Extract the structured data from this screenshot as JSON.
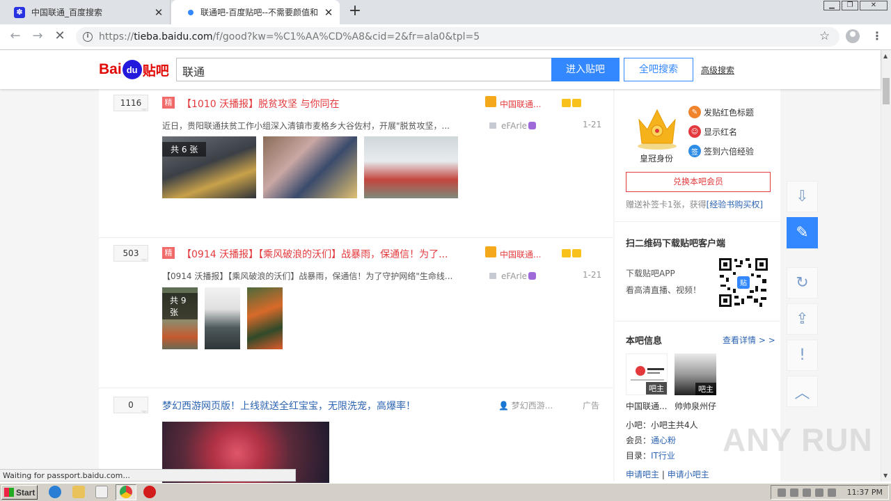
{
  "browser": {
    "tabs": [
      {
        "title": "中国联通_百度搜索",
        "active": false
      },
      {
        "title": "联通吧-百度贴吧--不需要颜值和才华",
        "active": true
      }
    ],
    "new_tab": "+",
    "url_prefix": "https://",
    "url_domain": "tieba.baidu.com",
    "url_path": "/f/good?kw=%C1%AA%CD%A8&cid=2&fr=ala0&tpl=5",
    "status": "Waiting for passport.baidu.com..."
  },
  "header": {
    "logo_bai": "Bai",
    "logo_du": "du",
    "logo_tieba": "贴吧",
    "search_value": "联通",
    "enter_bar": "进入贴吧",
    "search_all": "全吧搜索",
    "advanced": "高级搜索"
  },
  "threads": [
    {
      "reply_count": "1116",
      "tag": "精",
      "title": "【1010 沃播报】脱贫攻坚 与你同在",
      "author": "中国联通...",
      "snippet": "近日，贵阳联通扶贫工作小组深入清镇市麦格乡大谷佐村，开展\"脱贫攻坚，...",
      "last_replier": "eFArle",
      "date": "1-21",
      "pic_count": "共 6 张"
    },
    {
      "reply_count": "503",
      "tag": "精",
      "title": "【0914 沃播报】【乘风破浪的沃们】战暴雨，保通信！为了...",
      "author": "中国联通...",
      "snippet": "【0914 沃播报】【乘风破浪的沃们】战暴雨，保通信！为了守护网络\"生命线...",
      "last_replier": "eFArle",
      "date": "1-21",
      "pic_count": "共 9 张"
    },
    {
      "reply_count": "0",
      "title": "梦幻西游网页版！上线就送全红宝宝，无限洗宠，高爆率！",
      "author": "梦幻西游...",
      "ad_label": "广告"
    }
  ],
  "sidebar": {
    "crown_label": "皇冠身份",
    "perks": [
      "发贴红色标题",
      "显示红名",
      "签到六倍经验"
    ],
    "exchange": "兑换本吧会员",
    "gift_text": "赠送补签卡1张，获得",
    "gift_link": "[经验书购买权]",
    "qr_title": "扫二维码下载贴吧客户端",
    "qr_line1": "下载贴吧APP",
    "qr_line2": "看高清直播、视频！",
    "info_title": "本吧信息",
    "info_more": "查看详情",
    "info_more_arrow": "> >",
    "managers": [
      {
        "name": "中国联通...",
        "tag": "吧主"
      },
      {
        "name": "帅帅泉州仔",
        "tag": "吧主"
      }
    ],
    "small_mgr_label": "小吧：",
    "small_mgr_value": "小吧主共4人",
    "member_label": "会员：",
    "member_value": "通心粉",
    "dir_label": "目录：",
    "dir_value": "IT行业",
    "apply_mgr": "申请吧主",
    "apply_sep": "|",
    "apply_small": "申请小吧主"
  },
  "float_tools": [
    "download-icon",
    "edit-icon",
    "refresh-icon",
    "share-icon",
    "report-icon",
    "back-to-top-icon"
  ],
  "watermark": "ANY RUN",
  "taskbar": {
    "start": "Start",
    "clock": "11:37 PM"
  },
  "colors": {
    "accent": "#3388ff",
    "red": "#e4393c",
    "link": "#2d64b3"
  }
}
